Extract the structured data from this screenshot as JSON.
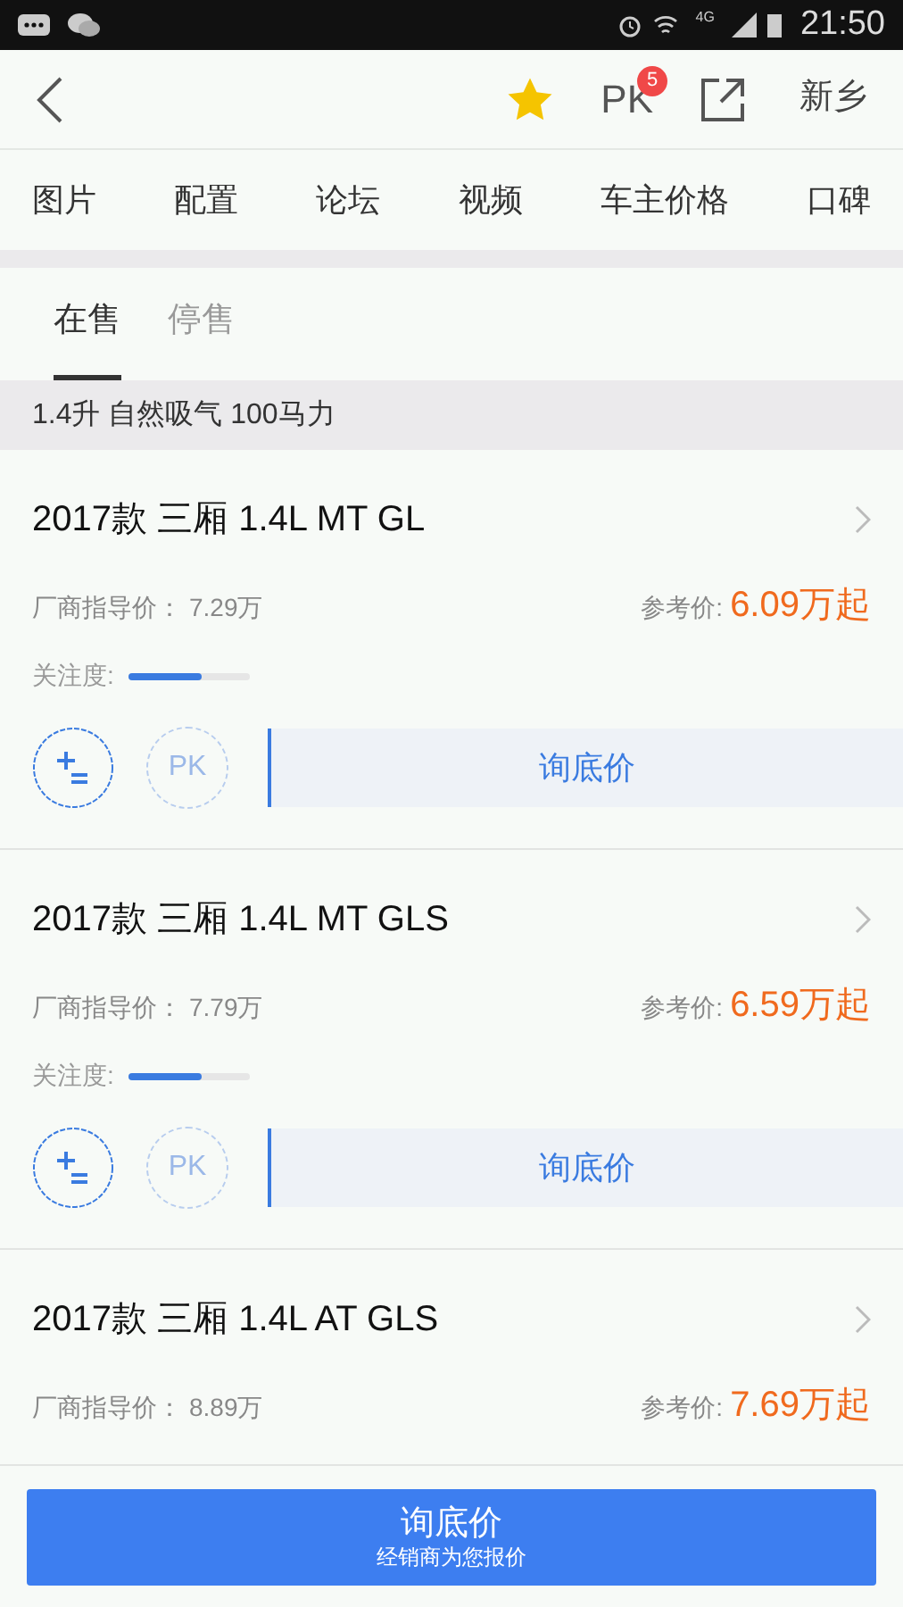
{
  "status_bar": {
    "network": "4G",
    "time": "21:50"
  },
  "header": {
    "pk_label": "PK",
    "pk_badge": "5",
    "city": "新乡",
    "favorited": true
  },
  "nav": [
    "图片",
    "配置",
    "论坛",
    "视频",
    "车主价格",
    "口碑"
  ],
  "tabs": [
    {
      "label": "在售",
      "selected": true
    },
    {
      "label": "停售",
      "selected": false
    }
  ],
  "group_header": "1.4升 自然吸气 100马力",
  "cars": [
    {
      "title": "2017款 三厢 1.4L MT GL",
      "guide_label": "厂商指导价：",
      "guide_price": "7.29万",
      "ref_label": "参考价:",
      "ref_price": "6.09万起",
      "attention_label": "关注度:",
      "level": 0.6,
      "pk_label": "PK",
      "inquiry_label": "询底价"
    },
    {
      "title": "2017款 三厢 1.4L MT GLS",
      "guide_label": "厂商指导价：",
      "guide_price": "7.79万",
      "ref_label": "参考价:",
      "ref_price": "6.59万起",
      "attention_label": "关注度:",
      "level": 0.6,
      "pk_label": "PK",
      "inquiry_label": "询底价"
    },
    {
      "title": "2017款 三厢 1.4L AT GLS",
      "guide_label": "厂商指导价：",
      "guide_price": "8.89万",
      "ref_label": "参考价:",
      "ref_price": "7.69万起"
    }
  ],
  "bottom_button": {
    "label": "询底价",
    "sublabel": "经销商为您报价"
  }
}
